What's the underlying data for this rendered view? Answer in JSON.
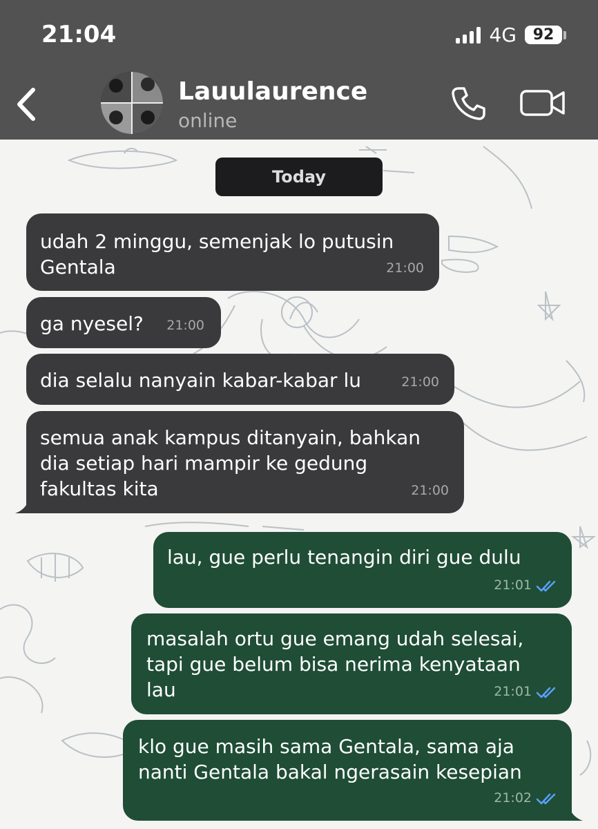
{
  "status_bar": {
    "time": "21:04",
    "network": "4G",
    "battery": "92"
  },
  "header": {
    "contact_name": "Lauulaurence",
    "contact_status": "online"
  },
  "chat": {
    "date_label": "Today",
    "messages": [
      {
        "direction": "in",
        "text": "udah 2 minggu, semenjak lo putusin\nGentala",
        "time": "21:00"
      },
      {
        "direction": "in",
        "text": "ga nyesel?",
        "time": "21:00"
      },
      {
        "direction": "in",
        "text": "dia selalu nanyain kabar-kabar lu",
        "time": "21:00"
      },
      {
        "direction": "in",
        "text": "semua anak kampus ditanyain, bahkan\ndia setiap hari mampir ke gedung\nfakultas kita",
        "time": "21:00"
      },
      {
        "direction": "out",
        "text": "lau, gue perlu tenangin diri gue dulu",
        "time": "21:01",
        "status": "read"
      },
      {
        "direction": "out",
        "text": "masalah ortu gue emang udah selesai,\ntapi gue belum bisa nerima kenyataan\nlau",
        "time": "21:01",
        "status": "read"
      },
      {
        "direction": "out",
        "text": "klo gue masih sama Gentala, sama aja\nnanti Gentala bakal ngerasain kesepian",
        "time": "21:02",
        "status": "read"
      }
    ]
  },
  "colors": {
    "header_bg": "#525252",
    "incoming_bubble": "#3a3a3c",
    "outgoing_bubble": "#1f4d36",
    "read_tick": "#5aa0ff"
  },
  "icons": {
    "back": "chevron-left-icon",
    "call": "phone-icon",
    "video": "video-camera-icon"
  }
}
